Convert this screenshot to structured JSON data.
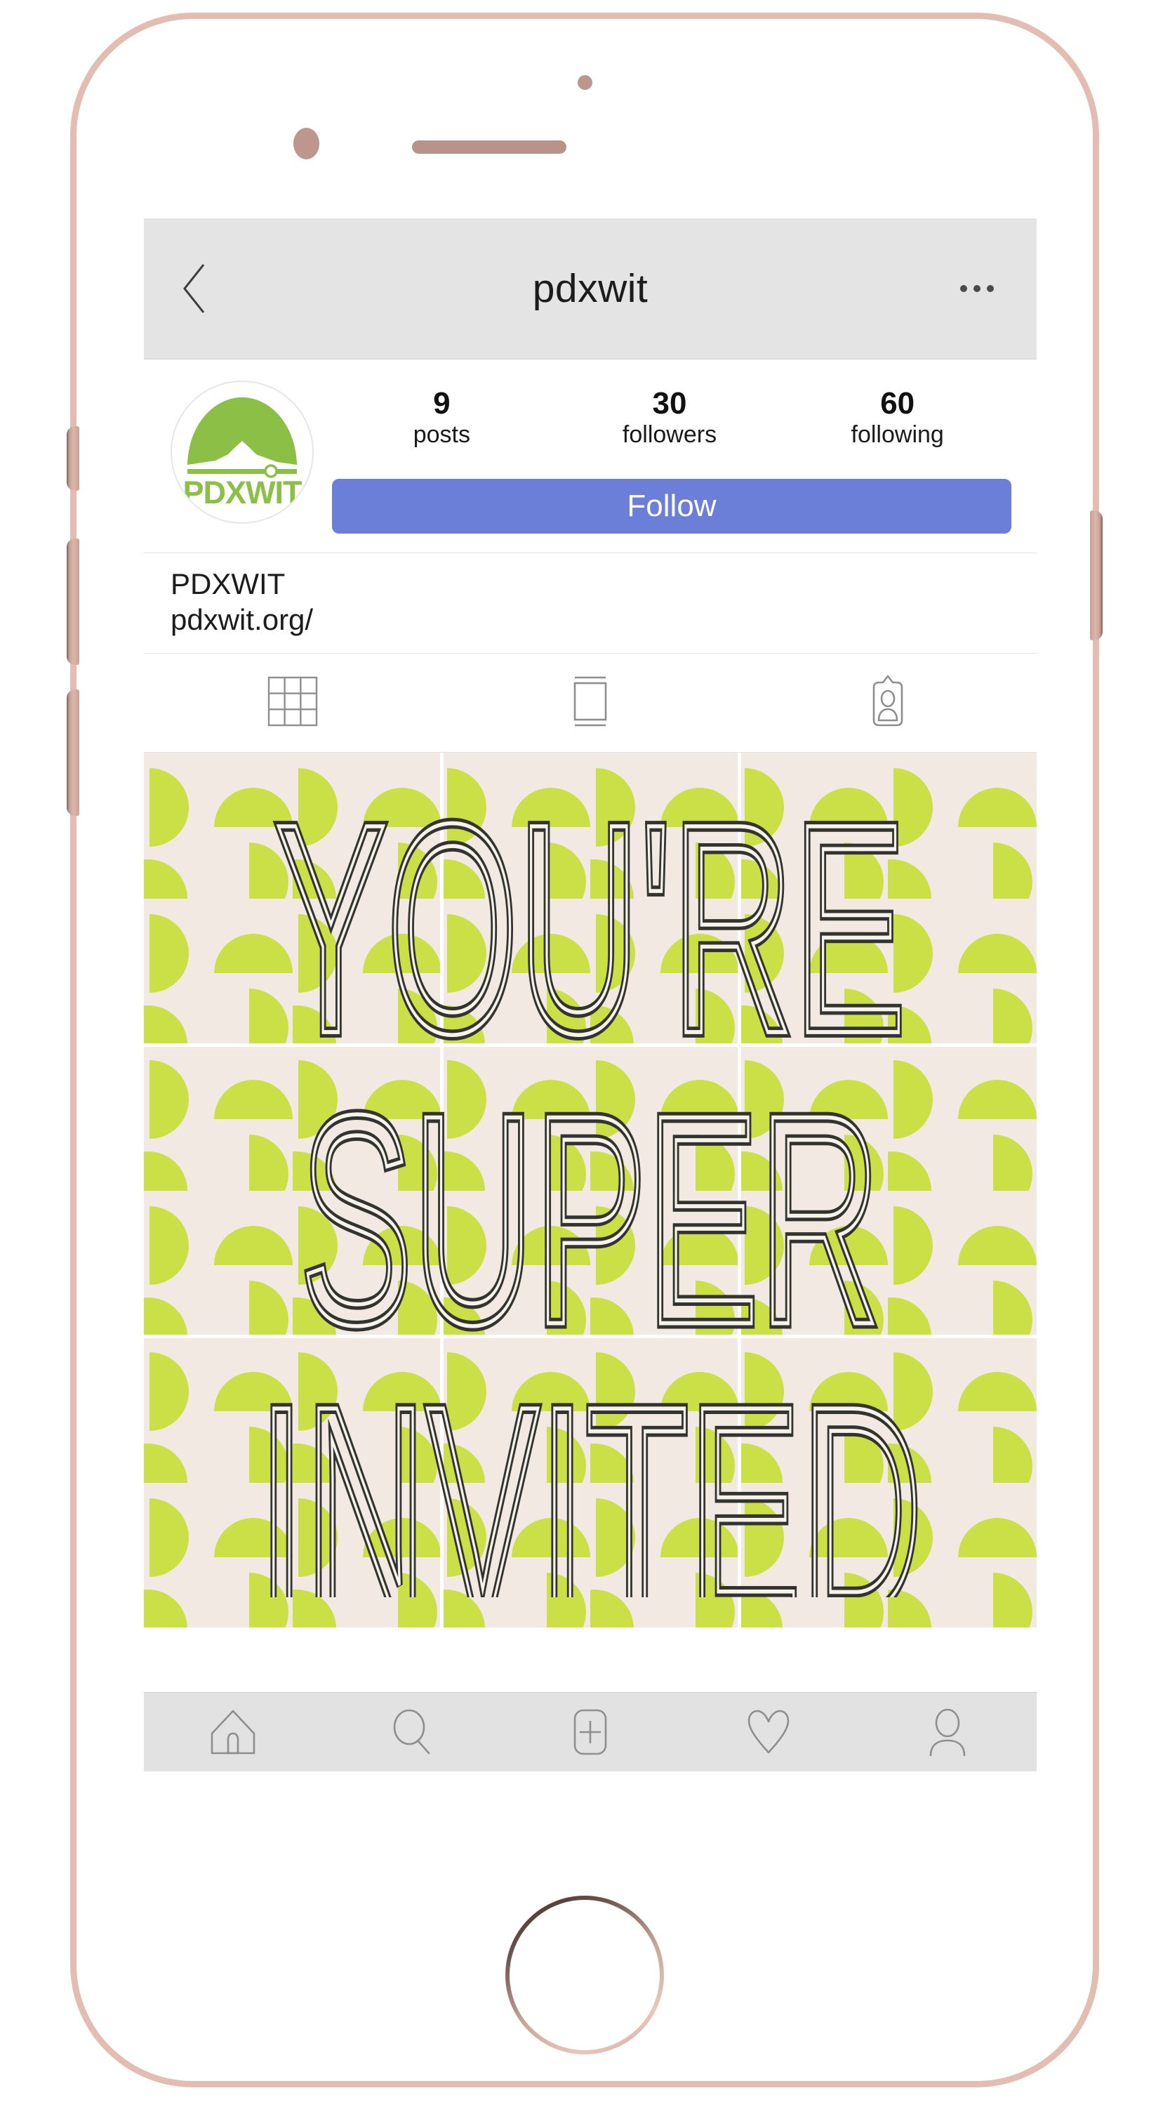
{
  "device": {
    "type": "smartphone-mockup",
    "frame_color": "#e3bdb1",
    "body_color": "#ffffff",
    "components": {
      "front_camera": "front-camera",
      "proximity_sensor": "proximity-sensor",
      "earpiece_speaker": "earpiece-speaker",
      "home_button": "home-button",
      "silent_switch": "silent-switch",
      "volume_up_button": "volume-up-button",
      "volume_down_button": "volume-down-button",
      "power_button": "power-button"
    }
  },
  "app": {
    "name": "instagram",
    "navbar": {
      "back_icon": "chevron-left-icon",
      "title": "pdxwit",
      "more_icon": "ellipsis-icon",
      "background": "#e4e4e4"
    },
    "profile": {
      "avatar_icon": "pdxwit-logo-avatar",
      "avatar_logo_text": "PDXWIT",
      "avatar_logo_color": "#8bbf45",
      "stats": [
        {
          "number": "9",
          "label": "posts"
        },
        {
          "number": "30",
          "label": "followers"
        },
        {
          "number": "60",
          "label": "following"
        }
      ],
      "follow_button": {
        "label": "Follow",
        "color": "#6b7ed8",
        "text_color": "#ffffff"
      },
      "bio": {
        "name": "PDXWIT",
        "website": "pdxwit.org/"
      }
    },
    "tabs": [
      {
        "name": "grid-view",
        "icon": "grid-icon",
        "selected": true
      },
      {
        "name": "list-view",
        "icon": "list-view-icon",
        "selected": false
      },
      {
        "name": "tagged-view",
        "icon": "tagged-photos-icon",
        "selected": false
      }
    ],
    "post_grid": {
      "columns": 3,
      "rows": 3,
      "total_tiles": 9,
      "grid_line_color": "#ffffff",
      "artwork": {
        "background_color": "#f2e9e3",
        "accent_color": "#cbe047",
        "shape": "half-circle",
        "text_color": "#33342f",
        "text_inline_color": "#f7f2ec",
        "lines": [
          "YOU'RE",
          "SUPER",
          "INVITED"
        ]
      }
    },
    "bottom_nav": [
      {
        "name": "home",
        "icon": "home-icon"
      },
      {
        "name": "search",
        "icon": "search-icon"
      },
      {
        "name": "add-post",
        "icon": "add-post-icon"
      },
      {
        "name": "activity",
        "icon": "heart-icon"
      },
      {
        "name": "profile",
        "icon": "person-icon"
      }
    ]
  }
}
